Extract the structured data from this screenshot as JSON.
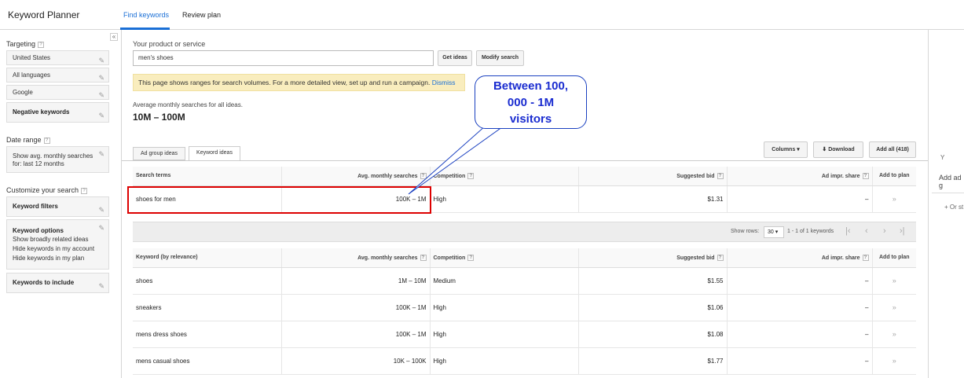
{
  "app_title": "Keyword Planner",
  "nav": {
    "find": "Find keywords",
    "review": "Review plan"
  },
  "sidebar": {
    "collapse": "«",
    "targeting_label": "Targeting",
    "targeting": [
      "United States",
      "All languages",
      "Google"
    ],
    "negative": "Negative keywords",
    "date_label": "Date range",
    "date_value_1": "Show avg. monthly searches",
    "date_value_2": "for: last 12 months",
    "customize_label": "Customize your search",
    "keyword_filters": "Keyword filters",
    "keyword_options": "Keyword options",
    "options": [
      "Show broadly related ideas",
      "Hide keywords in my account",
      "Hide keywords in my plan"
    ],
    "keywords_include": "Keywords to include"
  },
  "search": {
    "label": "Your product or service",
    "value": "men's shoes",
    "get_ideas": "Get ideas",
    "modify": "Modify search"
  },
  "notice": {
    "text": "This page shows ranges for search volumes. For a more detailed view, set up and run a campaign.",
    "dismiss": "Dismiss"
  },
  "summary": {
    "label": "Average monthly searches for all ideas.",
    "value": "10M – 100M"
  },
  "tabs": {
    "ad_group": "Ad group ideas",
    "keyword": "Keyword ideas"
  },
  "toolbar": {
    "columns": "Columns",
    "download": "Download",
    "add_all": "Add all (418)"
  },
  "table1": {
    "headers": [
      "Search terms",
      "Avg. monthly searches",
      "Competition",
      "Suggested bid",
      "Ad impr. share",
      "Add to plan"
    ],
    "rows": [
      {
        "term": "shoes for men",
        "avg": "100K – 1M",
        "comp": "High",
        "bid": "$1.31",
        "share": "–"
      }
    ]
  },
  "pager": {
    "show_rows": "Show rows:",
    "rows": "30",
    "range": "1 - 1 of 1 keywords"
  },
  "table2": {
    "headers": [
      "Keyword (by relevance)",
      "Avg. monthly searches",
      "Competition",
      "Suggested bid",
      "Ad impr. share",
      "Add to plan"
    ],
    "rows": [
      {
        "term": "shoes",
        "avg": "1M – 10M",
        "comp": "Medium",
        "bid": "$1.55",
        "share": "–"
      },
      {
        "term": "sneakers",
        "avg": "100K – 1M",
        "comp": "High",
        "bid": "$1.06",
        "share": "–"
      },
      {
        "term": "mens dress shoes",
        "avg": "100K – 1M",
        "comp": "High",
        "bid": "$1.08",
        "share": "–"
      },
      {
        "term": "mens casual shoes",
        "avg": "10K – 100K",
        "comp": "High",
        "bid": "$1.77",
        "share": "–"
      }
    ]
  },
  "right_panel": {
    "y": "Y",
    "add": "Add ad g",
    "or": "+ Or st"
  },
  "callout": {
    "line1": "Between 100,",
    "line2": "000 - 1M",
    "line3": "visitors"
  }
}
